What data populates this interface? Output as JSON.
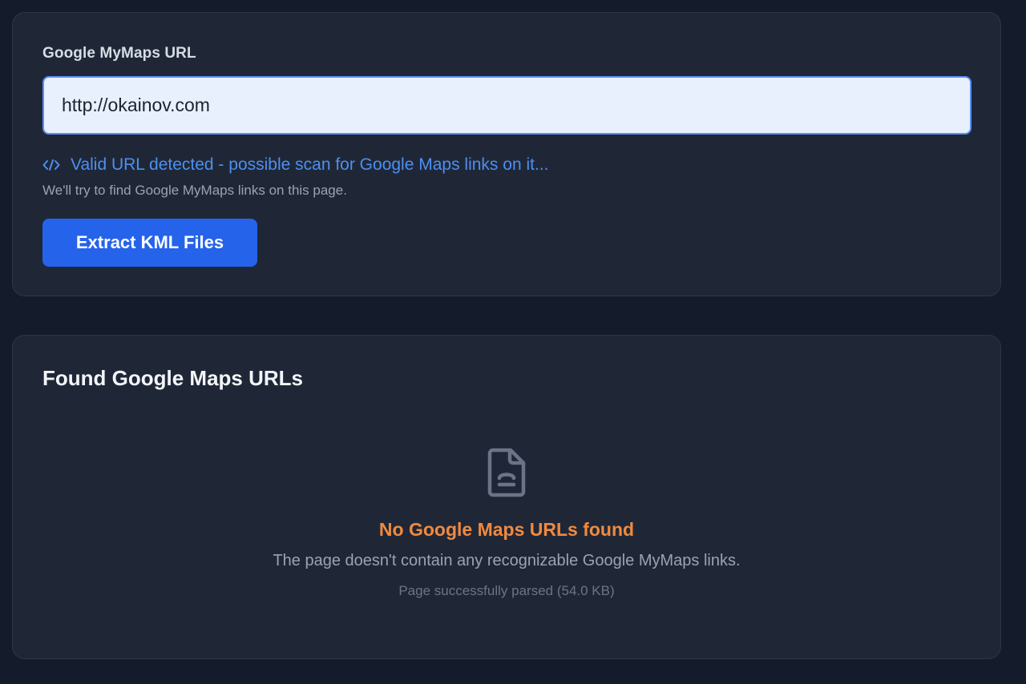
{
  "form": {
    "label": "Google MyMaps URL",
    "url_value": "http://okainov.com",
    "status_icon": "code-icon",
    "status_text": "Valid URL detected - possible scan for Google Maps links on it...",
    "helper_text": "We'll try to find Google MyMaps links on this page.",
    "submit_label": "Extract KML Files"
  },
  "results": {
    "title": "Found Google Maps URLs",
    "empty_icon": "document-icon",
    "empty_title": "No Google Maps URLs found",
    "empty_description": "The page doesn't contain any recognizable Google MyMaps links.",
    "empty_meta": "Page successfully parsed (54.0 KB)"
  },
  "colors": {
    "background": "#141b2b",
    "card": "#1f2737",
    "accent": "#2563eb",
    "status_blue": "#4d8ff0",
    "warning_orange": "#f08a3e"
  }
}
